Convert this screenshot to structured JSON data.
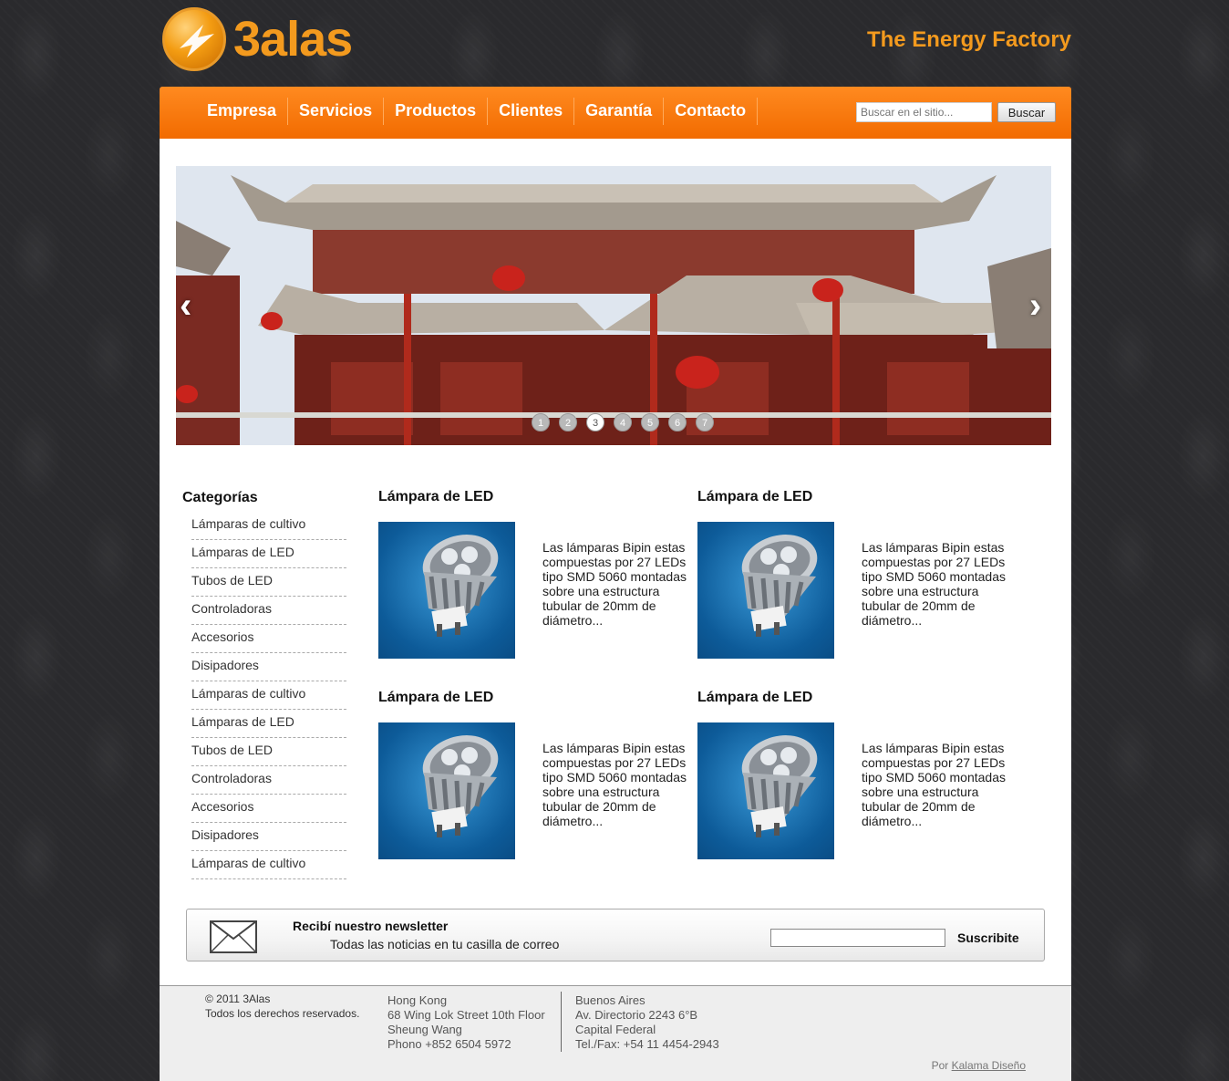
{
  "header": {
    "logo_text": "3alas",
    "tagline": "The Energy Factory"
  },
  "nav": {
    "items": [
      "Empresa",
      "Servicios",
      "Productos",
      "Clientes",
      "Garantía",
      "Contacto"
    ],
    "search_placeholder": "Buscar en el sitio...",
    "search_button": "Buscar"
  },
  "slider": {
    "dots": [
      "1",
      "2",
      "3",
      "4",
      "5",
      "6",
      "7"
    ],
    "active_dot": 3,
    "prev_label": "‹",
    "next_label": "›"
  },
  "sidebar": {
    "title": "Categorías",
    "items": [
      "Lámparas de cultivo",
      "Lámparas de LED",
      "Tubos de LED",
      "Controladoras",
      "Accesorios",
      "Disipadores",
      "Lámparas de cultivo",
      "Lámparas de LED",
      "Tubos de LED",
      "Controladoras",
      "Accesorios",
      "Disipadores",
      "Lámparas de cultivo"
    ]
  },
  "products": [
    {
      "title": "Lámpara de LED",
      "desc": "Las lámparas Bipin estas compuestas por 27 LEDs tipo SMD 5060 montadas sobre una estructura tubular de 20mm de diámetro..."
    },
    {
      "title": "Lámpara de LED",
      "desc": "Las lámparas Bipin estas compuestas por 27 LEDs tipo SMD 5060 montadas sobre una estructura tubular de 20mm de diámetro..."
    },
    {
      "title": "Lámpara de LED",
      "desc": "Las lámparas Bipin estas compuestas por 27 LEDs tipo SMD 5060 montadas sobre una estructura tubular de 20mm de diámetro..."
    },
    {
      "title": "Lámpara de LED",
      "desc": "Las lámparas Bipin estas compuestas por 27 LEDs tipo SMD 5060 montadas sobre una estructura tubular de 20mm de diámetro..."
    }
  ],
  "newsletter": {
    "title": "Recibí nuestro newsletter",
    "subtitle": "Todas las noticias en tu casilla de correo",
    "button": "Suscribite"
  },
  "footer": {
    "copyright": [
      "© 2011 3Alas",
      "Todos los derechos reservados."
    ],
    "hong_kong": [
      "Hong Kong",
      "68 Wing Lok Street 10th Floor",
      "Sheung Wang",
      "Phono +852 6504 5972"
    ],
    "buenos_aires": [
      "Buenos Aires",
      "Av. Directorio 2243 6°B",
      "Capital Federal",
      "Tel./Fax: +54 11 4454-2943"
    ],
    "credit_prefix": "Por",
    "credit_link": "Kalama Diseño"
  },
  "colors": {
    "brand_orange": "#f26b00",
    "logo_orange": "#f39a1e",
    "background": "#2a2a2d"
  }
}
